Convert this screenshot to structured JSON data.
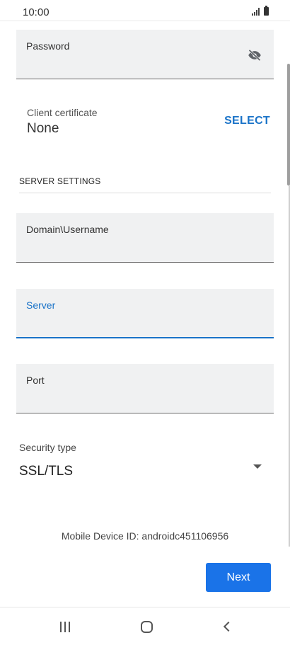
{
  "status_bar": {
    "time": "10:00"
  },
  "fields": {
    "password": {
      "label": "Password",
      "value": ""
    },
    "domain_username": {
      "label": "Domain\\Username",
      "value": ""
    },
    "server": {
      "label": "Server",
      "value": ""
    },
    "port": {
      "label": "Port",
      "value": ""
    }
  },
  "client_certificate": {
    "label": "Client certificate",
    "value": "None",
    "select_label": "SELECT"
  },
  "server_settings": {
    "header": "SERVER SETTINGS"
  },
  "security_type": {
    "label": "Security type",
    "value": "SSL/TLS"
  },
  "device_id": "Mobile Device ID: androidc451106956",
  "buttons": {
    "next": "Next"
  },
  "colors": {
    "accent": "#1a73e8",
    "field_bg": "#f0f1f2"
  },
  "icons": [
    "visibility-off-icon",
    "dropdown-arrow-icon",
    "recents-icon",
    "home-icon",
    "back-icon",
    "signal-icon",
    "battery-icon"
  ]
}
